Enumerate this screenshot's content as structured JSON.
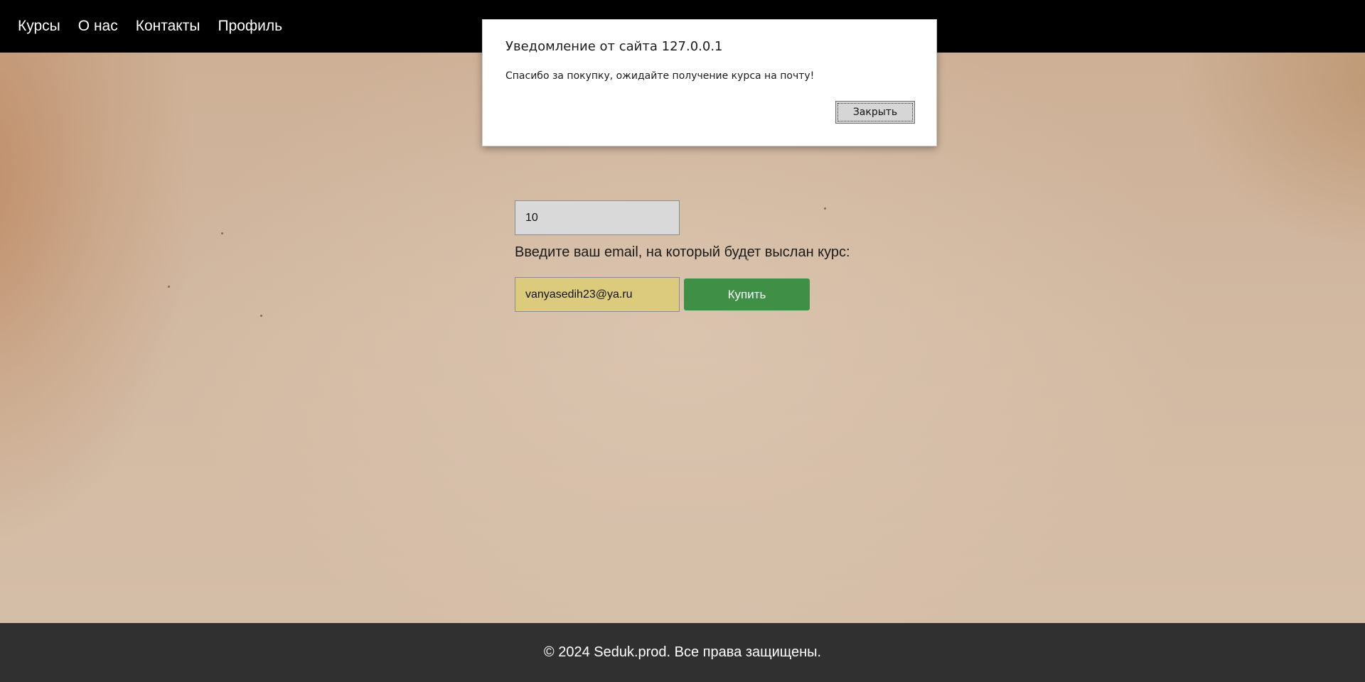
{
  "nav": {
    "items": [
      {
        "label": "Курсы"
      },
      {
        "label": "О нас"
      },
      {
        "label": "Контакты"
      },
      {
        "label": "Профиль"
      }
    ]
  },
  "form": {
    "quantity_value": "10",
    "email_label": "Введите ваш email, на который будет выслан курс:",
    "email_value": "vanyasedih23@ya.ru",
    "buy_label": "Купить"
  },
  "dialog": {
    "title": "Уведомление от сайта 127.0.0.1",
    "message": "Спасибо за покупку, ожидайте получение курса на почту!",
    "close_label": "Закрыть"
  },
  "footer": {
    "text": "© 2024 Seduk.prod. Все права защищены."
  },
  "colors": {
    "nav_bg": "#000000",
    "footer_bg": "#303030",
    "buy_button": "#3f8f46",
    "email_field": "#dccb7d"
  }
}
